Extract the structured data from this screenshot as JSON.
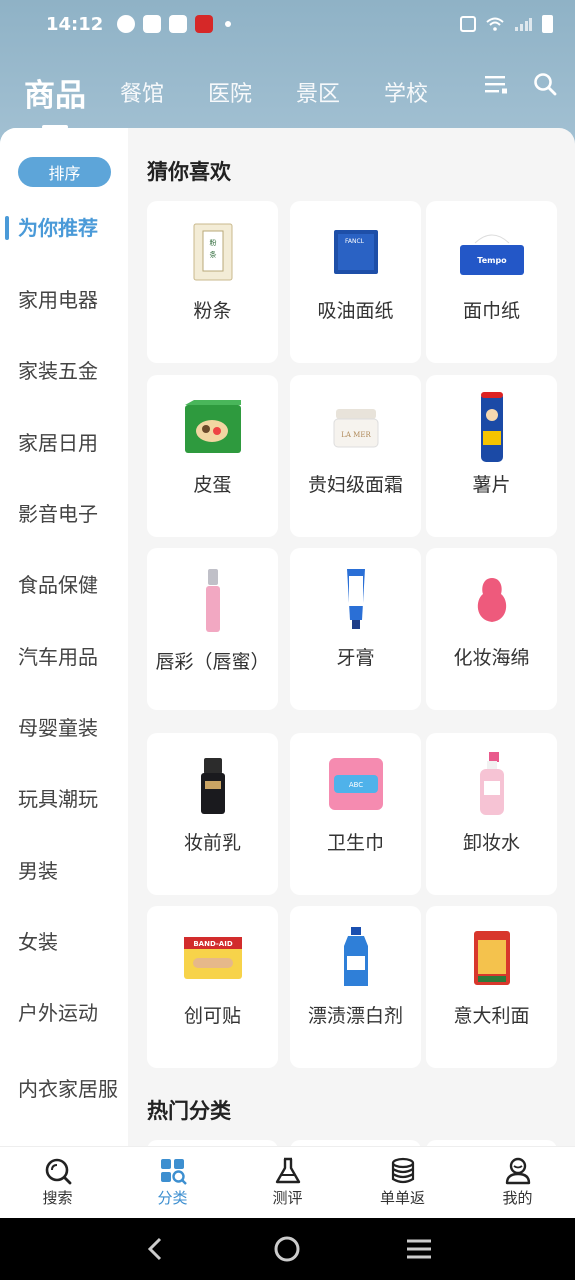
{
  "status_bar": {
    "time": "14:12"
  },
  "top_tabs": [
    {
      "label": "商品",
      "active": true
    },
    {
      "label": "餐馆",
      "active": false
    },
    {
      "label": "医院",
      "active": false
    },
    {
      "label": "景区",
      "active": false
    },
    {
      "label": "学校",
      "active": false
    }
  ],
  "sidebar": {
    "sort_label": "排序",
    "items": [
      "为你推荐",
      "家用电器",
      "家装五金",
      "家居日用",
      "影音电子",
      "食品保健",
      "汽车用品",
      "母婴童装",
      "玩具潮玩",
      "男装",
      "女装",
      "户外运动",
      "内衣家居服"
    ]
  },
  "main": {
    "section1_title": "猜你喜欢",
    "section2_title": "热门分类",
    "products": [
      {
        "name": "粉条",
        "icon": "vermicelli-pack"
      },
      {
        "name": "吸油面纸",
        "icon": "blotting-paper-box"
      },
      {
        "name": "面巾纸",
        "icon": "tissue-box"
      },
      {
        "name": "皮蛋",
        "icon": "preserved-egg-box"
      },
      {
        "name": "贵妇级面霜",
        "icon": "face-cream-jar"
      },
      {
        "name": "薯片",
        "icon": "chips-can"
      },
      {
        "name": "唇彩（唇蜜）",
        "icon": "lip-gloss"
      },
      {
        "name": "牙膏",
        "icon": "toothpaste"
      },
      {
        "name": "化妆海绵",
        "icon": "makeup-sponge"
      },
      {
        "name": "妆前乳",
        "icon": "primer-bottle"
      },
      {
        "name": "卫生巾",
        "icon": "sanitary-pad-pack"
      },
      {
        "name": "卸妆水",
        "icon": "makeup-remover-bottle"
      },
      {
        "name": "创可贴",
        "icon": "bandaid-box"
      },
      {
        "name": "漂渍漂白剂",
        "icon": "bleach-bottle"
      },
      {
        "name": "意大利面",
        "icon": "pasta-pack"
      }
    ]
  },
  "bottom_nav": [
    {
      "label": "搜索",
      "icon": "search-icon",
      "active": false
    },
    {
      "label": "分类",
      "icon": "category-icon",
      "active": true
    },
    {
      "label": "测评",
      "icon": "flask-icon",
      "active": false
    },
    {
      "label": "单单返",
      "icon": "coins-icon",
      "active": false
    },
    {
      "label": "我的",
      "icon": "user-icon",
      "active": false
    }
  ],
  "colors": {
    "accent": "#4a9ad8",
    "header": "#9bb9cc",
    "sort_pill": "#5da5d9"
  }
}
